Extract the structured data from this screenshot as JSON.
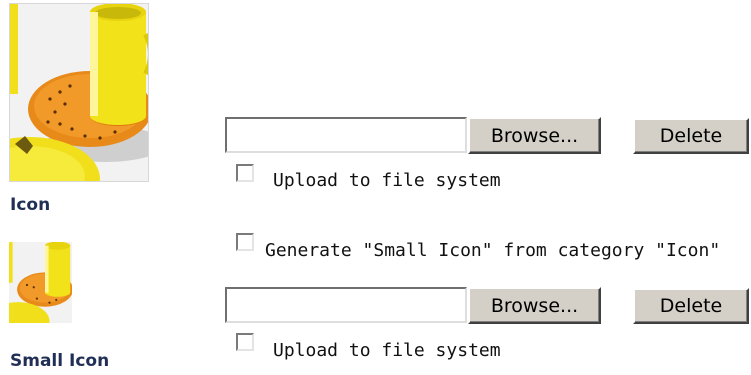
{
  "icon_section": {
    "caption": "Icon",
    "thumbnail_name": "cup-and-saucer-thumbnail",
    "browse_label": "Browse...",
    "delete_label": "Delete",
    "file_value": "",
    "upload_checkbox_label": "Upload to file system",
    "upload_checked": false
  },
  "small_icon_section": {
    "caption": "Small Icon",
    "generate_checkbox_label": "Generate \"Small Icon\" from category \"Icon\"",
    "generate_checked": false,
    "browse_label": "Browse...",
    "delete_label": "Delete",
    "file_value": "",
    "upload_checkbox_label": "Upload to file system",
    "upload_checked": false
  },
  "colors": {
    "caption": "#1f2f55",
    "button_face": "#d4d0c8",
    "cup_yellow": "#f2e21a",
    "saucer_orange": "#e88a1a"
  }
}
